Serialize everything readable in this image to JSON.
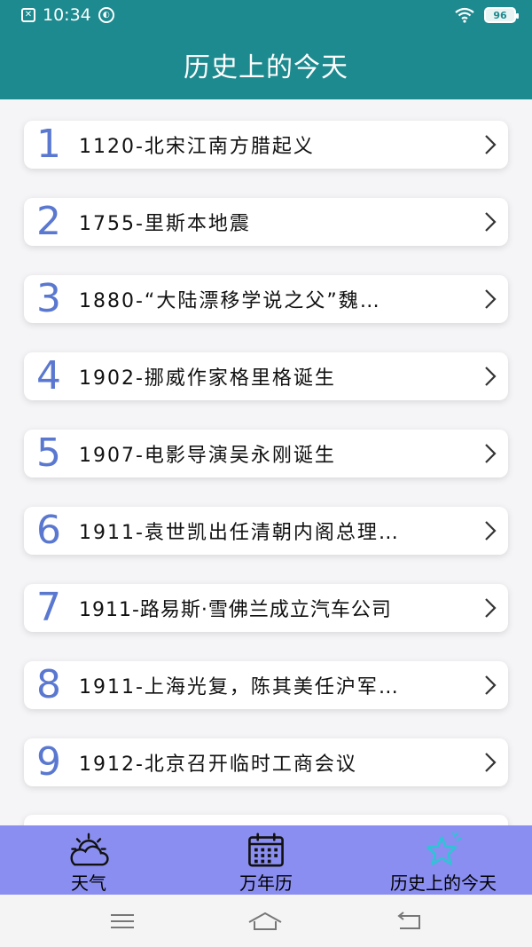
{
  "status_bar": {
    "time": "10:34",
    "battery": "96"
  },
  "header": {
    "title": "历史上的今天"
  },
  "events": [
    {
      "num": "1",
      "text": "1120-北宋江南方腊起义"
    },
    {
      "num": "2",
      "text": "1755-里斯本地震"
    },
    {
      "num": "3",
      "text": "1880-“大陆漂移学说之父”魏…"
    },
    {
      "num": "4",
      "text": "1902-挪威作家格里格诞生"
    },
    {
      "num": "5",
      "text": "1907-电影导演吴永刚诞生"
    },
    {
      "num": "6",
      "text": "1911-袁世凯出任清朝内阁总理…"
    },
    {
      "num": "7",
      "text": "1911-路易斯·雪佛兰成立汽车公司"
    },
    {
      "num": "8",
      "text": "1911-上海光复，陈其美任沪军…"
    },
    {
      "num": "9",
      "text": "1912-北京召开临时工商会议"
    }
  ],
  "tabs": [
    {
      "label": "天气",
      "icon": "weather-icon"
    },
    {
      "label": "万年历",
      "icon": "calendar-icon"
    },
    {
      "label": "历史上的今天",
      "icon": "star-icon",
      "active": true
    }
  ],
  "colors": {
    "header_bg": "#1d8a8f",
    "tab_bar_bg": "#8a8ef0",
    "number": "#5a78d0",
    "active_tab_icon": "#2ec4d6"
  }
}
